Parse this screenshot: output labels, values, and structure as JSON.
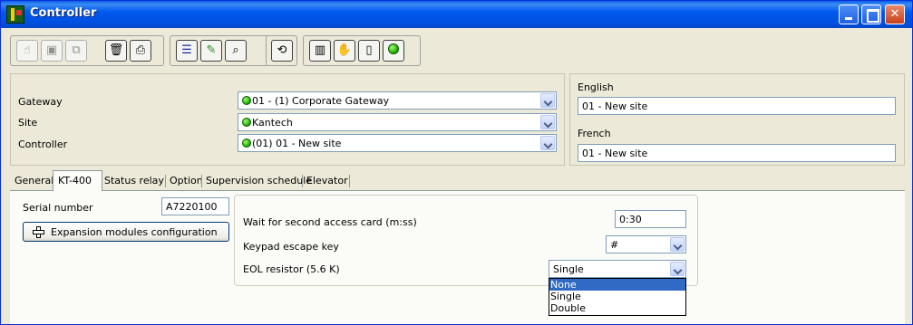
{
  "window": {
    "title": "Controller"
  },
  "title_buttons": [
    "minimize",
    "maximize",
    "close"
  ],
  "toolbar": {
    "buttons": [
      {
        "icon": "new-icon",
        "glyph": "☝",
        "enabled": false
      },
      {
        "icon": "save-icon",
        "glyph": "▣",
        "enabled": false
      },
      {
        "icon": "copy-icon",
        "glyph": "⧉",
        "enabled": false
      },
      {
        "icon": "delete-icon",
        "glyph": "🗑",
        "enabled": true
      },
      {
        "icon": "print-icon",
        "glyph": "⎙",
        "enabled": true
      },
      {
        "icon": "list-icon",
        "glyph": "☰",
        "enabled": true
      },
      {
        "icon": "link-icon",
        "glyph": "✎",
        "enabled": true
      },
      {
        "icon": "find-icon",
        "glyph": "⌕",
        "enabled": true
      },
      {
        "icon": "refresh-icon",
        "glyph": "⟲",
        "enabled": true
      },
      {
        "icon": "door-icon",
        "glyph": "▥",
        "enabled": true
      },
      {
        "icon": "access-icon",
        "glyph": "✋",
        "enabled": true
      },
      {
        "icon": "traffic-light-icon",
        "glyph": "▯",
        "enabled": true
      },
      {
        "icon": "status-icon",
        "glyph": "●",
        "enabled": true
      }
    ]
  },
  "selectors": {
    "gateway": {
      "label": "Gateway",
      "value": "01 - (1)  Corporate Gateway"
    },
    "site": {
      "label": "Site",
      "value": "Kantech"
    },
    "controller": {
      "label": "Controller",
      "value": "(01) 01 - New site"
    }
  },
  "descriptions": {
    "english": {
      "label": "English",
      "value": "01 - New site"
    },
    "french": {
      "label": "French",
      "value": "01 - New site"
    }
  },
  "tabs": [
    {
      "label": "General",
      "active": false
    },
    {
      "label": "KT-400",
      "active": true
    },
    {
      "label": "Status relay",
      "active": false
    },
    {
      "label": "Option",
      "active": false
    },
    {
      "label": "Supervision schedule",
      "active": false
    },
    {
      "label": "Elevator",
      "active": false
    }
  ],
  "kt400": {
    "serial_label": "Serial number",
    "serial_value": "A7220100",
    "expansion_button": "Expansion modules configuration",
    "wait_label": "Wait for second access card (m:ss)",
    "wait_value": "0:30",
    "keypad_label": "Keypad escape key",
    "keypad_value": "#",
    "eol_label": "EOL resistor (5.6 K)",
    "eol_value": "Single",
    "eol_options": [
      "None",
      "Single",
      "Double"
    ],
    "eol_highlighted": "None"
  },
  "colors": {
    "title_bar": "#0058ee",
    "highlight": "#316ac5",
    "status_green": "#1aa600"
  }
}
